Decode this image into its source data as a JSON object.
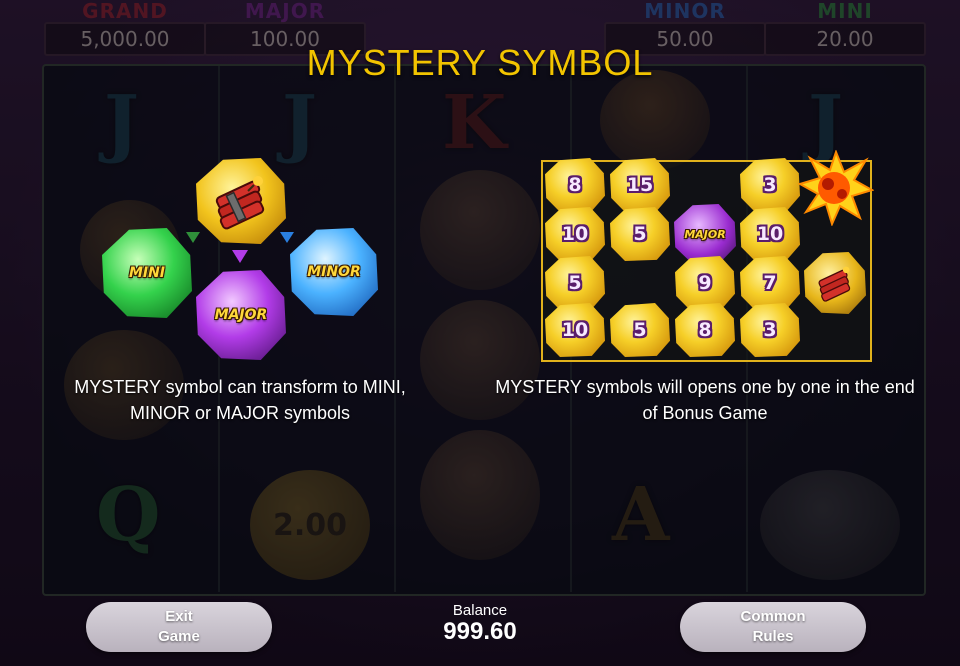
{
  "jackpots": [
    {
      "name": "GRAND",
      "value": "5,000.00",
      "color": "#c0262c"
    },
    {
      "name": "MAJOR",
      "value": "100.00",
      "color": "#8d2aa8"
    },
    {
      "name": "MINOR",
      "value": "50.00",
      "color": "#2a7fe0"
    },
    {
      "name": "MINI",
      "value": "20.00",
      "color": "#2fb342"
    }
  ],
  "background": {
    "letters": [
      "J",
      "J",
      "K",
      "J",
      "Q",
      "A"
    ],
    "coin_value": "2.00"
  },
  "title": "MYSTERY SYMBOL",
  "left_panel": {
    "description": "MYSTERY symbol can transform to MINI, MINOR or MAJOR symbols",
    "gems": {
      "mini": {
        "label": "MINI",
        "color": "#2fd24a"
      },
      "minor": {
        "label": "MINOR",
        "color": "#3aa8ff"
      },
      "major": {
        "label": "MAJOR",
        "color": "#b23ce8"
      }
    },
    "arrow_colors": [
      "#2f8f3a",
      "#b23ce8",
      "#2a7fe0"
    ]
  },
  "right_panel": {
    "description": "MYSTERY symbols will opens one by one in the end of Bonus Game",
    "grid": [
      [
        "8",
        "15",
        "",
        "3",
        "burst"
      ],
      [
        "10",
        "5",
        "MAJOR",
        "10",
        ""
      ],
      [
        "5",
        "",
        "9",
        "7",
        "mystery"
      ],
      [
        "10",
        "5",
        "8",
        "3",
        ""
      ]
    ]
  },
  "bottom_bar": {
    "exit_label": "Exit\nGame",
    "balance_label": "Balance",
    "balance_value": "999.60",
    "rules_label": "Common\nRules"
  },
  "icons": {
    "mystery": "dynamite-icon",
    "burst": "explosion-icon"
  },
  "colors": {
    "title": "#f2c400",
    "panel_border": "#e1b21c",
    "coin_gold": "#f6cf28"
  }
}
